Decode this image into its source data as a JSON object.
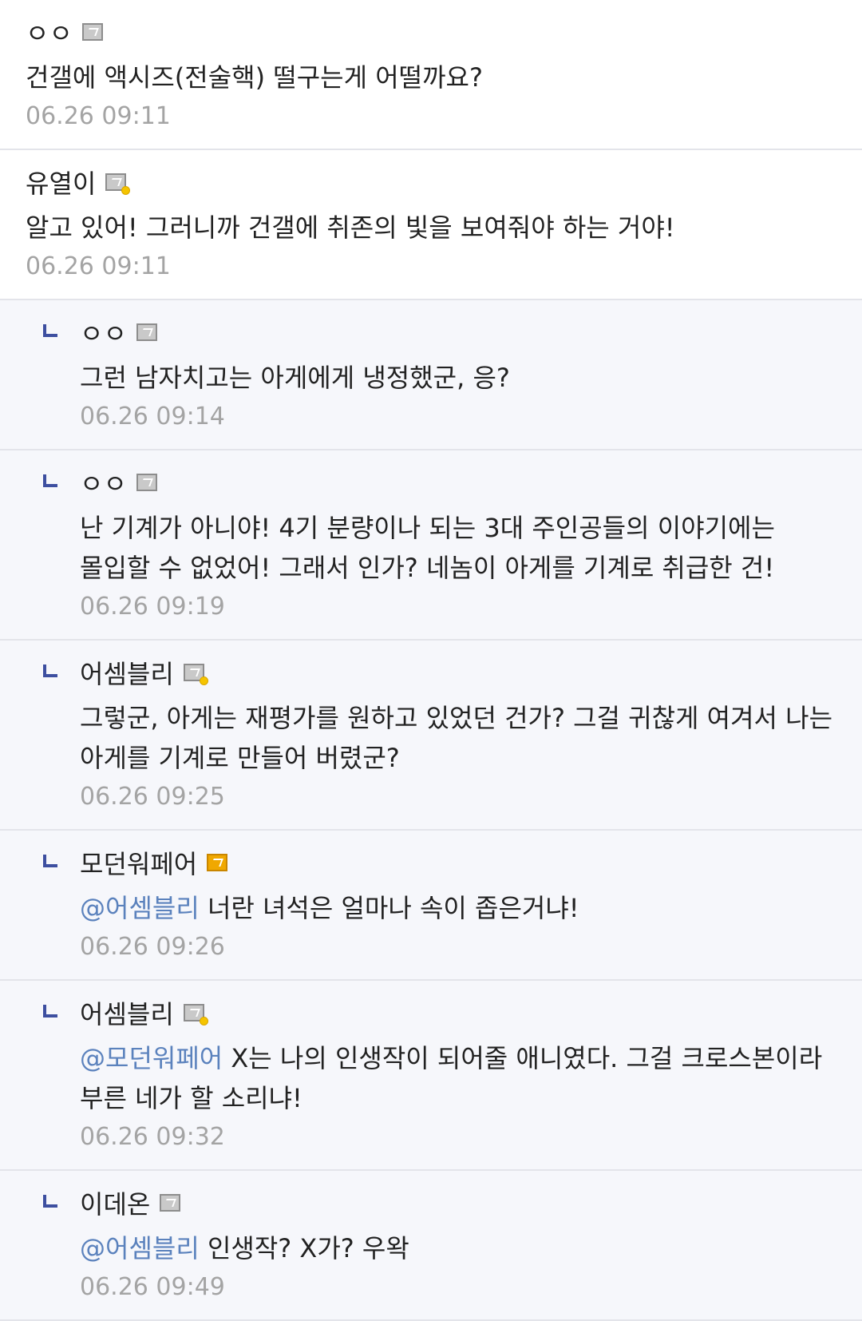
{
  "comments": [
    {
      "author": "ㅇㅇ",
      "badge": "level-icon",
      "badge_variant": "plain",
      "is_reply": false,
      "mention": "",
      "text": "건갤에 액시즈(전술핵) 떨구는게 어떨까요?",
      "time": "06.26 09:11"
    },
    {
      "author": "유열이",
      "badge": "level-icon",
      "badge_variant": "dot",
      "is_reply": false,
      "mention": "",
      "text": "알고 있어! 그러니까 건갤에 취존의 빛을 보여줘야 하는 거야!",
      "time": "06.26 09:11"
    },
    {
      "author": "ㅇㅇ",
      "badge": "level-icon",
      "badge_variant": "plain",
      "is_reply": true,
      "mention": "",
      "text": "그런 남자치고는 아게에게 냉정했군, 응?",
      "time": "06.26 09:14"
    },
    {
      "author": "ㅇㅇ",
      "badge": "level-icon",
      "badge_variant": "plain",
      "is_reply": true,
      "mention": "",
      "text": "난 기계가 아니야! 4기 분량이나 되는 3대 주인공들의 이야기에는 몰입할 수 없었어! 그래서 인가? 네놈이 아게를 기계로 취급한 건!",
      "time": "06.26 09:19"
    },
    {
      "author": "어셈블리",
      "badge": "level-icon",
      "badge_variant": "dot",
      "is_reply": true,
      "mention": "",
      "text": "그렇군, 아게는 재평가를 원하고 있었던 건가? 그걸 귀찮게 여겨서 나는 아게를 기계로 만들어 버렸군?",
      "time": "06.26 09:25"
    },
    {
      "author": "모던워페어",
      "badge": "level-icon",
      "badge_variant": "gold",
      "is_reply": true,
      "mention": "@어셈블리",
      "text": "너란 녀석은 얼마나 속이 좁은거냐!",
      "time": "06.26 09:26"
    },
    {
      "author": "어셈블리",
      "badge": "level-icon",
      "badge_variant": "dot",
      "is_reply": true,
      "mention": "@모던워페어",
      "text": "X는 나의 인생작이 되어줄 애니였다. 그걸 크로스본이라 부른 네가 할 소리냐!",
      "time": "06.26 09:32"
    },
    {
      "author": "이데온",
      "badge": "level-icon",
      "badge_variant": "plain",
      "is_reply": true,
      "mention": "@어셈블리",
      "text": "인생작? X가? 우왁",
      "time": "06.26 09:49"
    }
  ]
}
